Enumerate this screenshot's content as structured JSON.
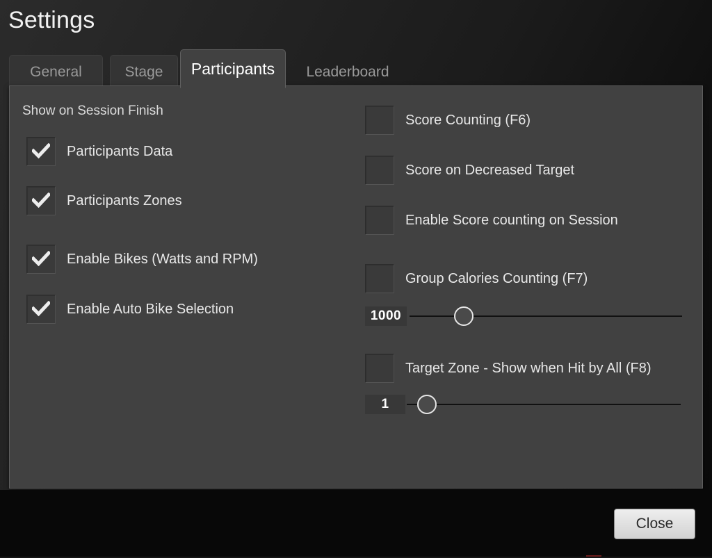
{
  "window": {
    "title": "Settings"
  },
  "tabs": [
    {
      "id": "general",
      "label": "General",
      "active": false
    },
    {
      "id": "stage",
      "label": "Stage",
      "active": false
    },
    {
      "id": "participants",
      "label": "Participants",
      "active": true
    },
    {
      "id": "leaderboard",
      "label": "Leaderboard",
      "active": false
    }
  ],
  "panel": {
    "section_label": "Show on Session Finish",
    "left_column": [
      {
        "id": "participants-data",
        "label": "Participants Data",
        "checked": true
      },
      {
        "id": "participants-zones",
        "label": "Participants Zones",
        "checked": true
      },
      {
        "id": "enable-bikes",
        "label": "Enable Bikes (Watts and RPM)",
        "checked": true
      },
      {
        "id": "enable-auto-bike-selection",
        "label": "Enable Auto Bike Selection",
        "checked": true
      }
    ],
    "right_column": [
      {
        "id": "score-counting",
        "label": "Score Counting (F6)",
        "checked": false
      },
      {
        "id": "score-on-decreased-target",
        "label": "Score on Decreased Target",
        "checked": false
      },
      {
        "id": "enable-score-counting-session",
        "label": "Enable Score counting on Session",
        "checked": false
      },
      {
        "id": "group-calories-counting",
        "label": "Group Calories Counting (F7)",
        "checked": false
      },
      {
        "id": "target-zone-hit-by-all",
        "label": "Target Zone - Show when Hit by All (F8)",
        "checked": false
      }
    ],
    "sliders": [
      {
        "id": "group-calories-slider",
        "value": "1000"
      },
      {
        "id": "target-zone-slider",
        "value": "1"
      }
    ]
  },
  "footer": {
    "close_label": "Close"
  },
  "colors": {
    "panel_bg": "#414141",
    "panel_border": "#5e5e5e",
    "active_tab_bg": "#414141",
    "inactive_tab_bg": "#343434",
    "text_primary": "#e8e8e8",
    "text_muted": "#9a9a9a",
    "checkbox_bg": "#3a3a3a",
    "slider_track": "#111111",
    "close_button_bg": "#dedede"
  }
}
